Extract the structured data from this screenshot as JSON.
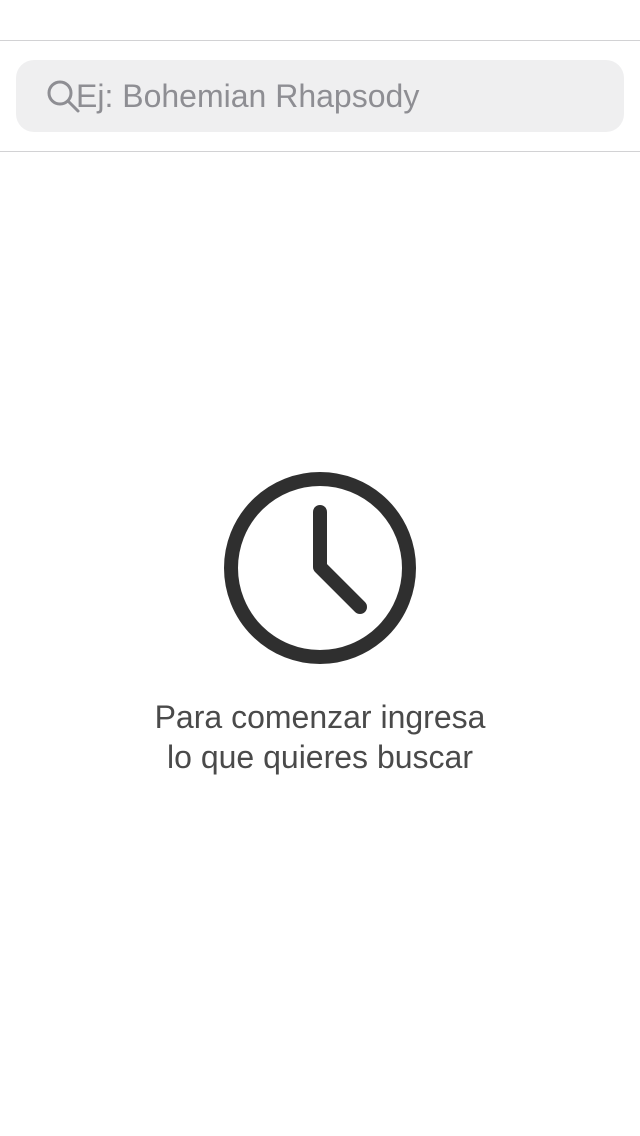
{
  "search": {
    "value": "",
    "placeholder": "Ej: Bohemian Rhapsody",
    "icon": "search-icon"
  },
  "empty_state": {
    "icon": "clock-icon",
    "line1": "Para comenzar ingresa",
    "line2": "lo que quieres buscar"
  },
  "colors": {
    "background": "#ffffff",
    "search_field": "#efeff0",
    "placeholder": "#8e8e93",
    "icon": "#2f2f2f",
    "text": "#4a4a4a",
    "divider": "#d2d2d4"
  }
}
